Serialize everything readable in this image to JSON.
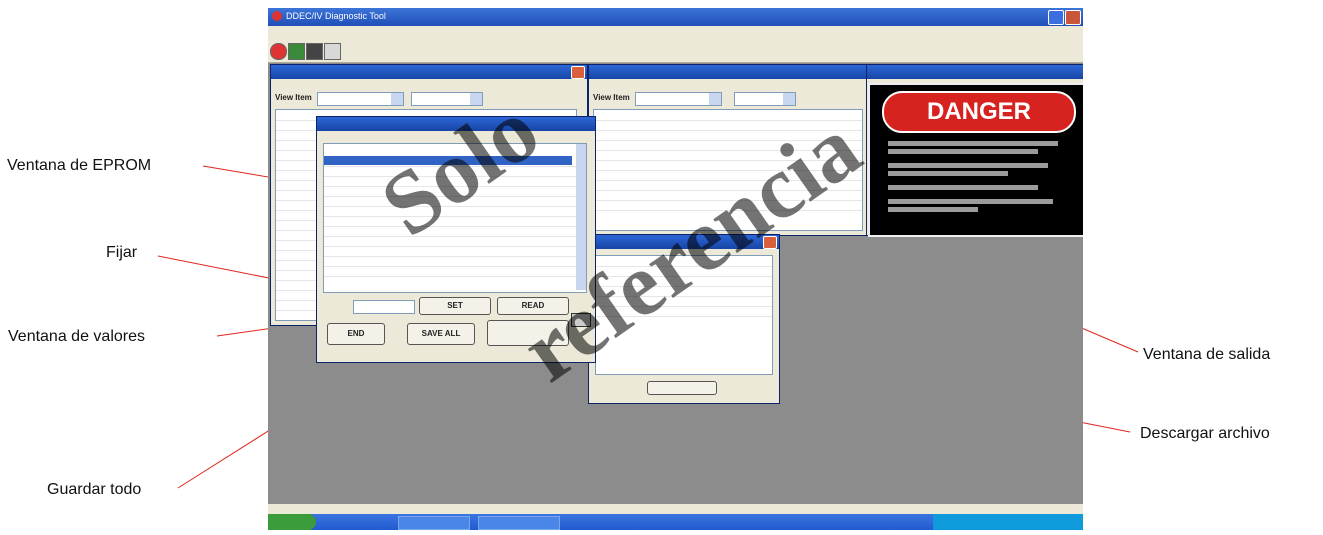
{
  "callouts": {
    "eprom_window": "Ventana de EPROM",
    "set": "Fijar",
    "values_window": "Ventana de valores",
    "save_all": "Guardar todo",
    "output_window": "Ventana de salida",
    "download_file": "Descargar archivo"
  },
  "app": {
    "title": "DDEC/IV Diagnostic Tool",
    "danger": "DANGER",
    "buttons": {
      "set": "SET",
      "read": "READ",
      "end": "END",
      "save_all": "SAVE ALL"
    },
    "view_item_label": "View Item"
  },
  "watermark": [
    "Solo",
    "referencia"
  ],
  "colors": {
    "callout_line": "#e0261b",
    "title_bar": "#1f4fb8",
    "danger_red": "#d6231f"
  }
}
